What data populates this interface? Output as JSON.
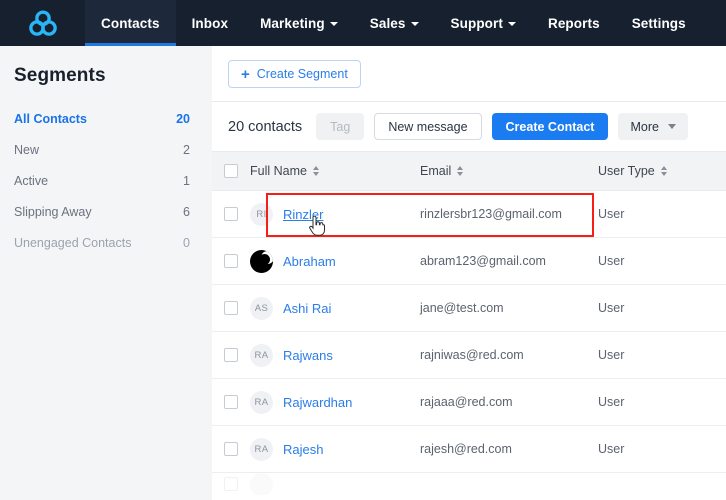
{
  "topnav": {
    "logo_icon": "trinity-rings-logo",
    "items": [
      {
        "label": "Contacts",
        "active": true,
        "has_caret": false
      },
      {
        "label": "Inbox",
        "active": false,
        "has_caret": false
      },
      {
        "label": "Marketing",
        "active": false,
        "has_caret": true
      },
      {
        "label": "Sales",
        "active": false,
        "has_caret": true
      },
      {
        "label": "Support",
        "active": false,
        "has_caret": true
      },
      {
        "label": "Reports",
        "active": false,
        "has_caret": false
      },
      {
        "label": "Settings",
        "active": false,
        "has_caret": false
      }
    ]
  },
  "sidebar": {
    "title": "Segments",
    "items": [
      {
        "label": "All Contacts",
        "count": "20",
        "active": true,
        "muted": false
      },
      {
        "label": "New",
        "count": "2",
        "active": false,
        "muted": false
      },
      {
        "label": "Active",
        "count": "1",
        "active": false,
        "muted": false
      },
      {
        "label": "Slipping Away",
        "count": "6",
        "active": false,
        "muted": false
      },
      {
        "label": "Unengaged Contacts",
        "count": "0",
        "active": false,
        "muted": true
      }
    ]
  },
  "toolbar": {
    "create_segment_label": "Create Segment",
    "plus_icon": "plus-icon"
  },
  "actionbar": {
    "contacts_count_label": "20 contacts",
    "tag_label": "Tag",
    "new_message_label": "New message",
    "create_contact_label": "Create Contact",
    "more_label": "More",
    "more_caret_icon": "chevron-down-icon"
  },
  "table": {
    "columns": [
      {
        "key": "full_name",
        "label": "Full Name",
        "sortable": true
      },
      {
        "key": "email",
        "label": "Email",
        "sortable": true
      },
      {
        "key": "user_type",
        "label": "User Type",
        "sortable": true
      }
    ],
    "rows": [
      {
        "initials": "RI",
        "avatar_type": "initials",
        "name": "Rinzler",
        "email": "rinzlersbr123@gmail.com",
        "user_type": "User",
        "hovered": true
      },
      {
        "initials": "",
        "avatar_type": "photo",
        "name": "Abraham",
        "email": "abram123@gmail.com",
        "user_type": "User",
        "hovered": false
      },
      {
        "initials": "AS",
        "avatar_type": "initials",
        "name": "Ashi Rai",
        "email": "jane@test.com",
        "user_type": "User",
        "hovered": false
      },
      {
        "initials": "RA",
        "avatar_type": "initials",
        "name": "Rajwans",
        "email": "rajniwas@red.com",
        "user_type": "User",
        "hovered": false
      },
      {
        "initials": "RA",
        "avatar_type": "initials",
        "name": "Rajwardhan",
        "email": "rajaaa@red.com",
        "user_type": "User",
        "hovered": false
      },
      {
        "initials": "RA",
        "avatar_type": "initials",
        "name": "Rajesh",
        "email": "rajesh@red.com",
        "user_type": "User",
        "hovered": false
      }
    ]
  },
  "annotation": {
    "highlight_color": "#f71e18",
    "highlighted_row_index": 0,
    "cursor_icon": "pointer-hand-cursor"
  },
  "colors": {
    "nav_background": "#17202e",
    "nav_active_underline": "#1f7ae0",
    "accent_blue": "#1a7cf0",
    "link_blue": "#2b7de9",
    "sidebar_background": "#f4f5f7",
    "logo_cyan": "#29b6f6"
  }
}
